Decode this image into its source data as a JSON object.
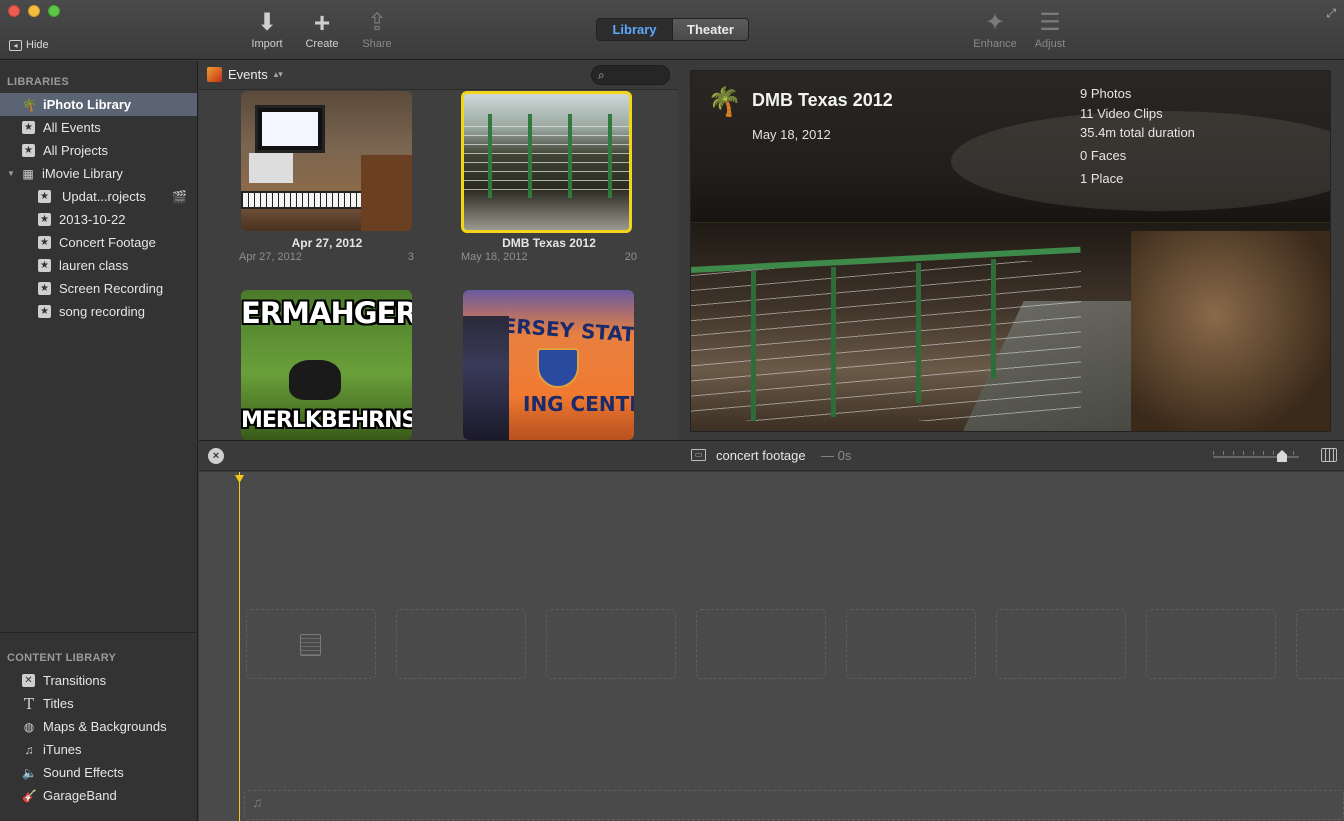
{
  "toolbar": {
    "hide_label": "Hide",
    "import_label": "Import",
    "create_label": "Create",
    "share_label": "Share",
    "enhance_label": "Enhance",
    "adjust_label": "Adjust",
    "view_tabs": [
      {
        "label": "Library",
        "active": true
      },
      {
        "label": "Theater",
        "active": false
      }
    ]
  },
  "sidebar": {
    "libraries_heading": "LIBRARIES",
    "items": [
      {
        "label": "iPhoto Library",
        "icon": "palm-icon",
        "selected": true
      },
      {
        "label": "All Events",
        "icon": "star-icon"
      },
      {
        "label": "All Projects",
        "icon": "star-icon"
      },
      {
        "label": "iMovie Library",
        "icon": "grid-icon"
      },
      {
        "label": "Updat...rojects",
        "icon": "star-icon"
      },
      {
        "label": "2013-10-22",
        "icon": "star-icon"
      },
      {
        "label": "Concert Footage",
        "icon": "star-icon"
      },
      {
        "label": "lauren class",
        "icon": "star-icon"
      },
      {
        "label": "Screen Recording",
        "icon": "star-icon"
      },
      {
        "label": "song recording",
        "icon": "star-icon"
      }
    ],
    "content_heading": "CONTENT LIBRARY",
    "content_items": [
      {
        "label": "Transitions",
        "icon": "transitions-icon"
      },
      {
        "label": "Titles",
        "icon": "titles-icon"
      },
      {
        "label": "Maps & Backgrounds",
        "icon": "globe-icon"
      },
      {
        "label": "iTunes",
        "icon": "music-note-icon"
      },
      {
        "label": "Sound Effects",
        "icon": "speaker-icon"
      },
      {
        "label": "GarageBand",
        "icon": "guitar-icon"
      }
    ]
  },
  "browser": {
    "heading": "Events",
    "search_placeholder": "",
    "events": [
      {
        "title": "Apr 27, 2012",
        "date": "Apr 27, 2012",
        "count": "3"
      },
      {
        "title": "DMB Texas 2012",
        "date": "May 18, 2012",
        "count": "20",
        "selected": true
      },
      {
        "title": "ERMAHGERD",
        "caption_bottom": "MERLKBEHRNS"
      },
      {
        "title": "JERSEY STATE POL",
        "caption_bottom": "ING CENTER"
      }
    ]
  },
  "viewer": {
    "title": "DMB Texas 2012",
    "date": "May 18, 2012",
    "stats": [
      "9 Photos",
      "11 Video Clips",
      "35.4m total duration",
      "0 Faces",
      "1 Place"
    ]
  },
  "project": {
    "name": "concert footage",
    "duration": "— 0s"
  }
}
